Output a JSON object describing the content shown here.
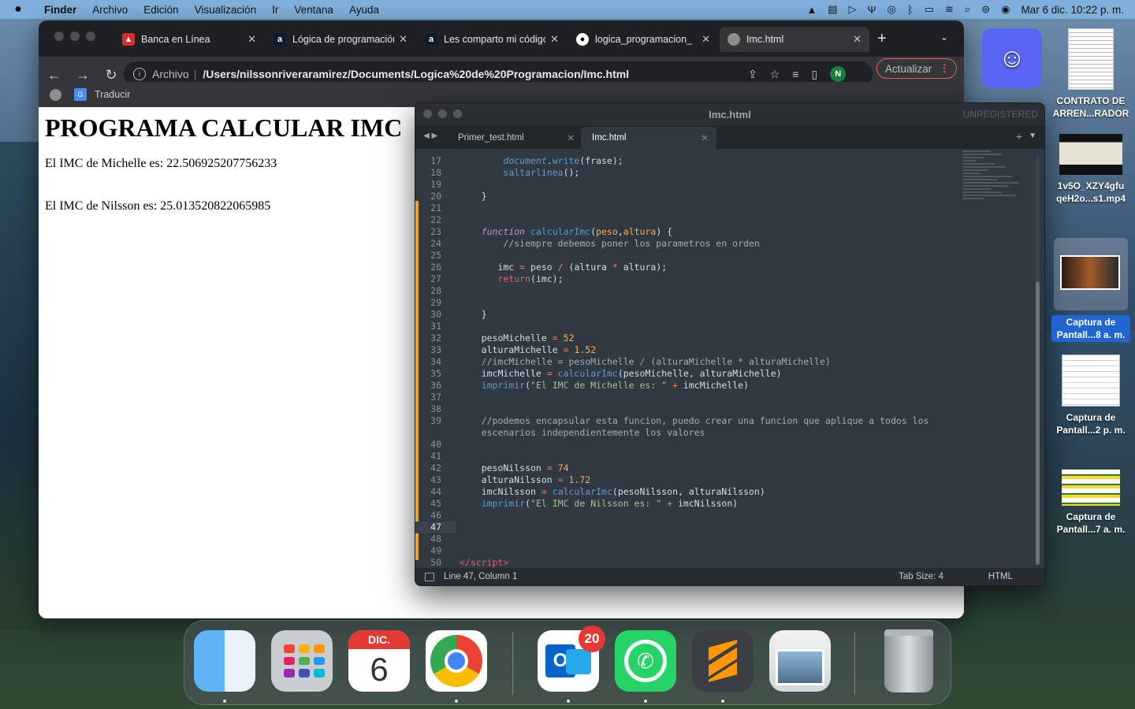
{
  "menubar": {
    "app": "Finder",
    "items": [
      "Archivo",
      "Edición",
      "Visualización",
      "Ir",
      "Ventana",
      "Ayuda"
    ],
    "datetime": "Mar 6 dic.  10:22 p. m."
  },
  "chrome": {
    "tabs": [
      {
        "title": "Banca en Línea",
        "icon": "bank-icon"
      },
      {
        "title": "Lógica de programación",
        "icon": "a-letter-icon"
      },
      {
        "title": "Les comparto mi código",
        "icon": "a-letter-icon"
      },
      {
        "title": "logica_programacion_",
        "icon": "github-icon"
      },
      {
        "title": "Imc.html",
        "icon": "globe-icon"
      }
    ],
    "scheme": "Archivo",
    "url": "/Users/nilssonriveraramirez/Documents/Logica%20de%20Programacion/Imc.html",
    "profile_initial": "N",
    "update_label": "Actualizar",
    "bookmark_label": "Traducir"
  },
  "page": {
    "heading": "PROGRAMA CALCULAR IMC",
    "line1": "El IMC de Michelle es: 22.506925207756233",
    "line2": "El IMC de Nilsson es: 25.013520822065985"
  },
  "sublime": {
    "title": "Imc.html",
    "unregistered": "UNREGISTERED",
    "tabs": [
      "Primer_test.html",
      "Imc.html"
    ],
    "status_position": "Line 47, Column 1",
    "tab_size": "Tab Size: 4",
    "syntax": "HTML",
    "current_line": 47
  },
  "desktop": {
    "icons": [
      {
        "label": "",
        "name": "discord-drive"
      },
      {
        "label": "CONTRATO DE ARREN...RADOR"
      },
      {
        "label": "1v5O_XZY4gfu qeH2o...s1.mp4"
      },
      {
        "label": "Captura de Pantall...8 a. m."
      },
      {
        "label": "Captura de Pantall...2 p. m."
      },
      {
        "label": "Captura de Pantall...7 a. m."
      }
    ]
  },
  "dock": {
    "calendar_month": "DIC.",
    "calendar_day": "6",
    "outlook_badge": "20"
  },
  "colors": {
    "sublime_bg": "#303841",
    "chrome_dark": "#35363a",
    "menubar": "#7fb0dc"
  }
}
